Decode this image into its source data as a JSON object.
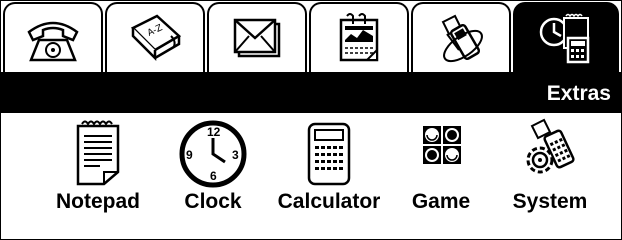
{
  "tabs": [
    {
      "name": "phone",
      "icon": "telephone-icon",
      "active": false
    },
    {
      "name": "contacts",
      "icon": "address-book-icon",
      "active": false
    },
    {
      "name": "messages",
      "icon": "envelope-icon",
      "active": false
    },
    {
      "name": "calendar",
      "icon": "calendar-icon",
      "active": false
    },
    {
      "name": "connectivity",
      "icon": "phone-signal-icon",
      "active": false
    },
    {
      "name": "extras",
      "icon": "clock-calculator-icon",
      "active": true
    }
  ],
  "header": {
    "title": "Extras"
  },
  "apps": [
    {
      "label": "Notepad",
      "icon": "notepad-icon"
    },
    {
      "label": "Clock",
      "icon": "clock-icon"
    },
    {
      "label": "Calculator",
      "icon": "calculator-icon"
    },
    {
      "label": "Game",
      "icon": "game-board-icon"
    },
    {
      "label": "System",
      "icon": "system-gear-phone-icon"
    }
  ],
  "colors": {
    "foreground": "#000000",
    "background": "#ffffff",
    "active_tab": "#000000"
  }
}
